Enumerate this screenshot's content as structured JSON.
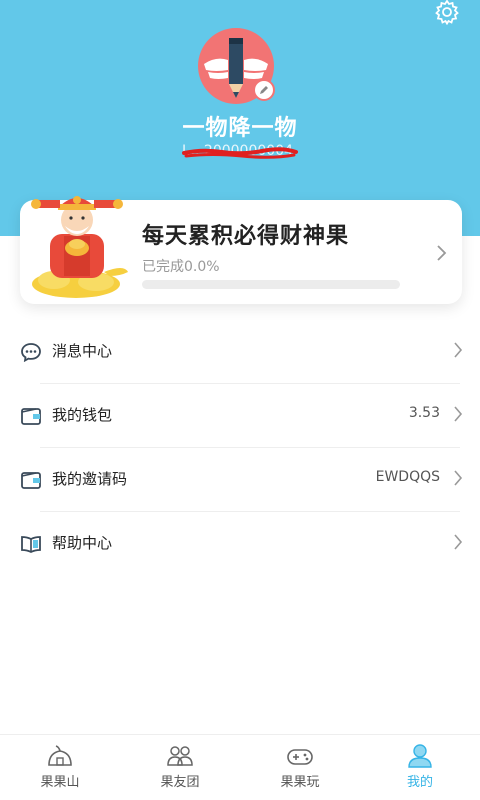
{
  "theme": {
    "header_color": "#62c8e9",
    "accent": "#36b4e6",
    "avatar_color": "#f27474"
  },
  "header": {
    "settings_icon": "gear-icon",
    "username": "一物降一物",
    "user_id": "I... 2000000004"
  },
  "task_card": {
    "title": "每天累积必得财神果",
    "progress_text": "已完成0.0%",
    "progress": 0.0
  },
  "menu": [
    {
      "icon": "message-bubble-icon",
      "label": "消息中心",
      "value": ""
    },
    {
      "icon": "wallet-icon",
      "label": "我的钱包",
      "value": "3.53"
    },
    {
      "icon": "wallet-icon",
      "label": "我的邀请码",
      "value": "EWDQQS"
    },
    {
      "icon": "book-icon",
      "label": "帮助中心",
      "value": ""
    }
  ],
  "tabbar": [
    {
      "icon": "fruit-mountain-icon",
      "label": "果果山",
      "active": false
    },
    {
      "icon": "group-icon",
      "label": "果友团",
      "active": false
    },
    {
      "icon": "gamepad-icon",
      "label": "果果玩",
      "active": false
    },
    {
      "icon": "user-icon",
      "label": "我的",
      "active": true
    }
  ]
}
